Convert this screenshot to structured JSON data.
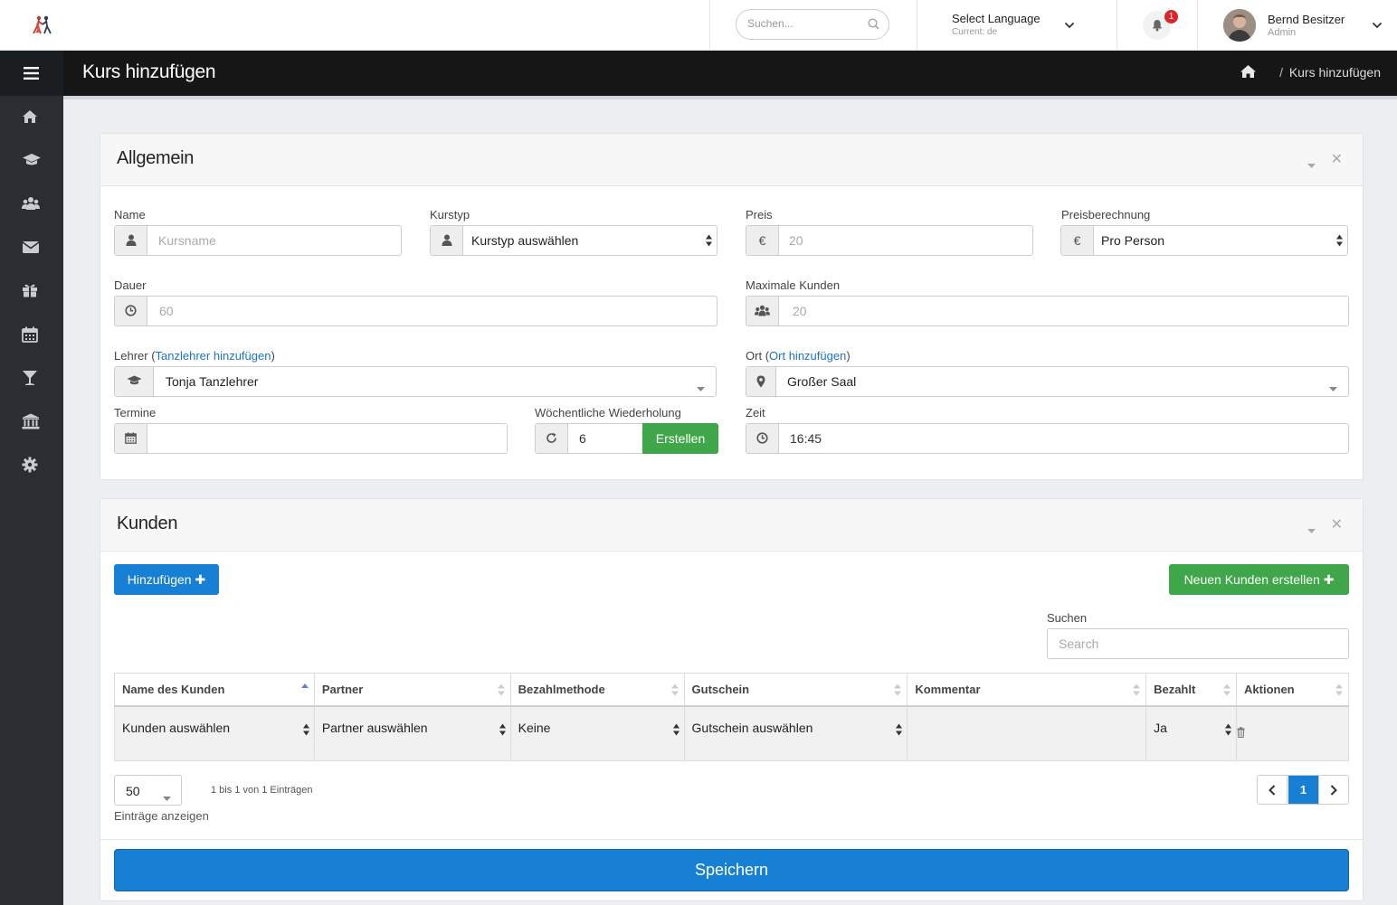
{
  "topbar": {
    "search_placeholder": "Suchen...",
    "language": {
      "title": "Select Language",
      "current": "Current: de"
    },
    "notifications": {
      "count": "1"
    },
    "user": {
      "name": "Bernd Besitzer",
      "role": "Admin"
    }
  },
  "sidebar": {
    "items": [
      "home-icon",
      "graduation-cap-icon",
      "users-icon",
      "envelope-icon",
      "gift-icon",
      "calendar-icon",
      "cocktail-icon",
      "bank-icon",
      "gear-icon"
    ]
  },
  "header": {
    "title": "Kurs hinzufügen",
    "breadcrumb_sep": "/",
    "breadcrumb_current": "Kurs hinzufügen"
  },
  "allgemein": {
    "title": "Allgemein",
    "name": {
      "label": "Name",
      "placeholder": "Kursname"
    },
    "kurstyp": {
      "label": "Kurstyp",
      "value": "Kurstyp auswählen"
    },
    "preis": {
      "label": "Preis",
      "currency": "€",
      "placeholder": "20"
    },
    "preisberechnung": {
      "label": "Preisberechnung",
      "currency": "€",
      "value": "Pro Person"
    },
    "dauer": {
      "label": "Dauer",
      "placeholder": "60"
    },
    "max_kunden": {
      "label": "Maximale Kunden",
      "placeholder": "20"
    },
    "lehrer": {
      "label": "Lehrer",
      "link_open": "(",
      "link": "Tanzlehrer hinzufügen",
      "link_close": ")",
      "value": "Tonja Tanzlehrer"
    },
    "ort": {
      "label": "Ort",
      "link_open": "(",
      "link": "Ort hinzufügen",
      "link_close": ")",
      "value": "Großer Saal"
    },
    "termine": {
      "label": "Termine",
      "value": ""
    },
    "wiederholung": {
      "label": "Wöchentliche Wiederholung",
      "value": "6",
      "button": "Erstellen"
    },
    "zeit": {
      "label": "Zeit",
      "value": "16:45"
    }
  },
  "kunden": {
    "title": "Kunden",
    "add_button": "Hinzufügen",
    "new_button": "Neuen Kunden erstellen",
    "search_label": "Suchen",
    "search_placeholder": "Search",
    "columns": [
      "Name des Kunden",
      "Partner",
      "Bezahlmethode",
      "Gutschein",
      "Kommentar",
      "Bezahlt",
      "Aktionen"
    ],
    "row": [
      "Kunden auswählen",
      "Partner auswählen",
      "Keine",
      "Gutschein auswählen",
      "",
      "Ja"
    ],
    "page_size": "50",
    "info": "1 bis 1 von 1 Einträgen",
    "show_label": "Einträge anzeigen",
    "current_page": "1"
  },
  "save_button": "Speichern",
  "colors": {
    "primary": "#1780d4",
    "success": "#3fa64a",
    "sidebar": "#2a2e33",
    "header": "#161616",
    "badge": "#d9262b"
  }
}
